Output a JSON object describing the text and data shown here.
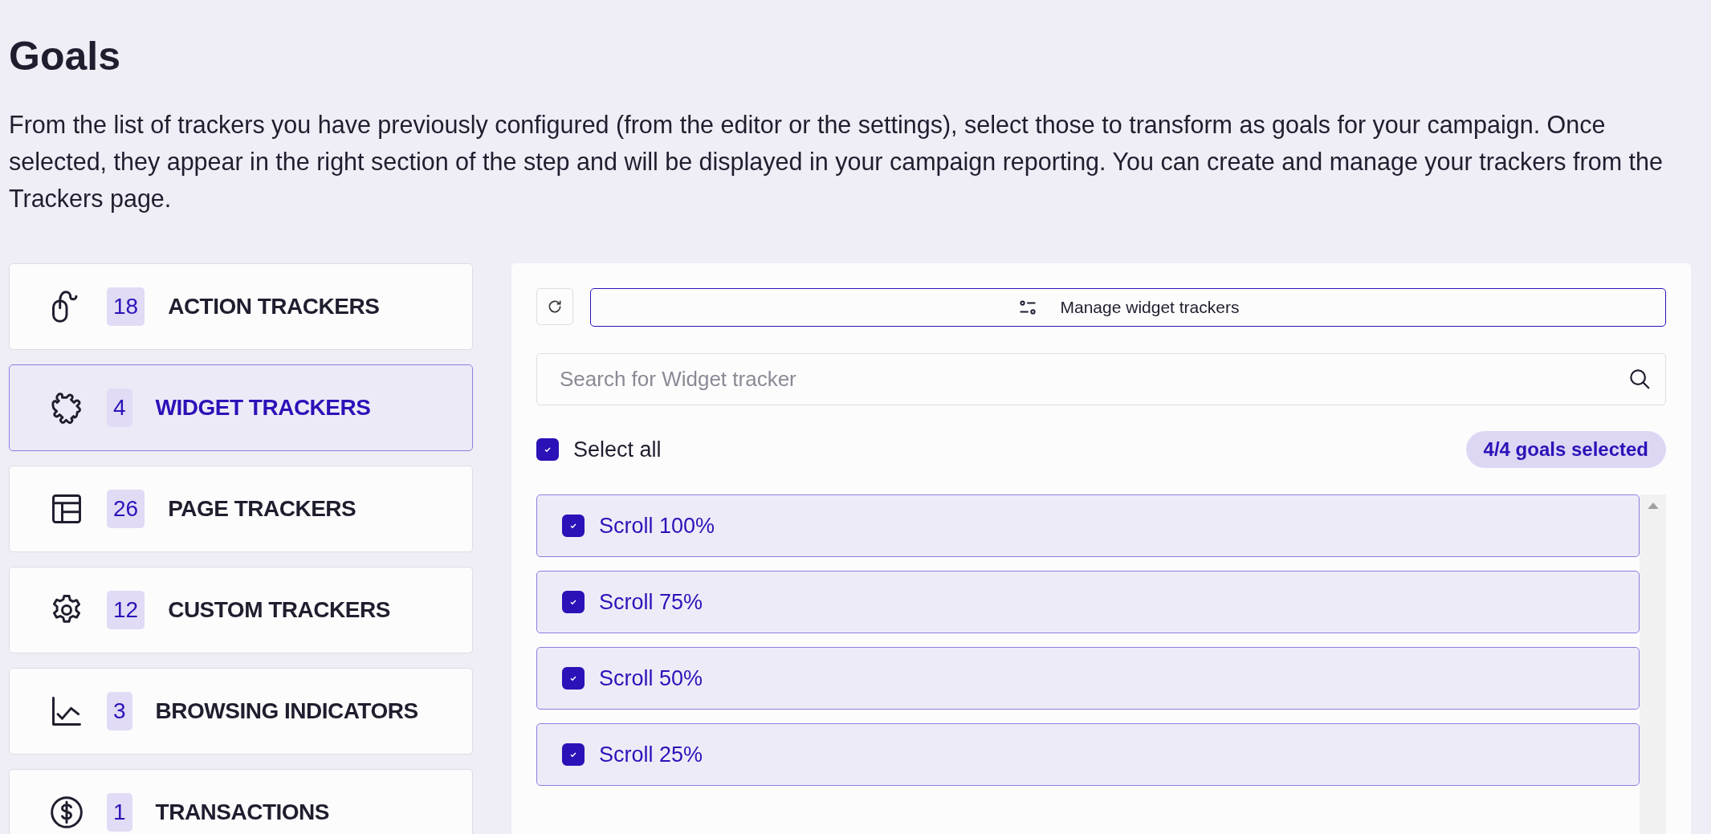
{
  "title": "Goals",
  "description": "From the list of trackers you have previously configured (from the editor or the settings), select those to transform as goals for your campaign. Once selected, they appear in the right section of the step and will be displayed in your campaign reporting. You can create and manage your trackers from the Trackers page.",
  "categories": [
    {
      "count": "18",
      "label": "ACTION TRACKERS",
      "selected": false
    },
    {
      "count": "4",
      "label": "WIDGET TRACKERS",
      "selected": true
    },
    {
      "count": "26",
      "label": "PAGE TRACKERS",
      "selected": false
    },
    {
      "count": "12",
      "label": "CUSTOM TRACKERS",
      "selected": false
    },
    {
      "count": "3",
      "label": "BROWSING INDICATORS",
      "selected": false
    },
    {
      "count": "1",
      "label": "TRANSACTIONS",
      "selected": false
    }
  ],
  "panel": {
    "manage_button": "Manage widget trackers",
    "search": {
      "placeholder": "Search for Widget tracker"
    },
    "select_all": {
      "label": "Select all",
      "checked": true
    },
    "selected_badge": "4/4 goals selected",
    "goals": [
      {
        "label": "Scroll 100%",
        "checked": true
      },
      {
        "label": "Scroll 75%",
        "checked": true
      },
      {
        "label": "Scroll 50%",
        "checked": true
      },
      {
        "label": "Scroll 25%",
        "checked": true
      }
    ]
  }
}
